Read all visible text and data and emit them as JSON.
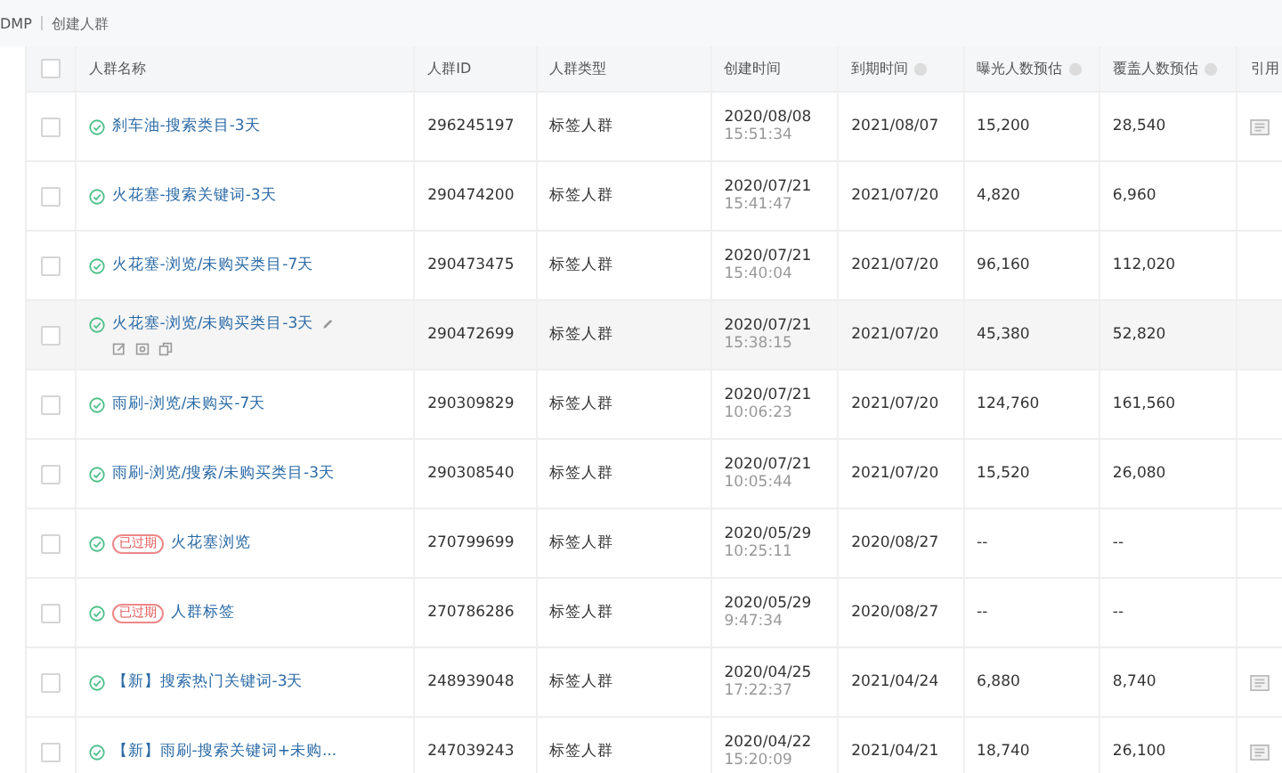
{
  "breadcrumb": [
    "DMP",
    "创建人群"
  ],
  "table": {
    "all_checked": false,
    "columns": [
      {
        "label": "人群名称",
        "help": false
      },
      {
        "label": "人群ID",
        "help": false
      },
      {
        "label": "人群类型",
        "help": false
      },
      {
        "label": "创建时间",
        "help": false
      },
      {
        "label": "到期时间",
        "help": true
      },
      {
        "label": "曝光人数预估",
        "help": true
      },
      {
        "label": "覆盖人数预估",
        "help": true
      },
      {
        "label": "引用"
      }
    ],
    "rows": [
      {
        "name": "刹车油-搜索类目-3天",
        "id": "296245197",
        "type": "标签人群",
        "created_date": "2020/08/08",
        "created_time": "15:51:34",
        "expiry": "2021/08/07",
        "exposure": "15,200",
        "coverage": "28,540",
        "referenced": true,
        "hovered": false,
        "checked": false
      },
      {
        "name": "火花塞-搜索关键词-3天",
        "id": "290474200",
        "type": "标签人群",
        "created_date": "2020/07/21",
        "created_time": "15:41:47",
        "expiry": "2021/07/20",
        "exposure": "4,820",
        "coverage": "6,960",
        "referenced": false,
        "hovered": false,
        "checked": false
      },
      {
        "name": "火花塞-浏览/未购买类目-7天",
        "id": "290473475",
        "type": "标签人群",
        "created_date": "2020/07/21",
        "created_time": "15:40:04",
        "expiry": "2021/07/20",
        "exposure": "96,160",
        "coverage": "112,020",
        "referenced": false,
        "hovered": false,
        "checked": false
      },
      {
        "name": "火花塞-浏览/未购买类目-3天",
        "id": "290472699",
        "type": "标签人群",
        "created_date": "2020/07/21",
        "created_time": "15:38:15",
        "expiry": "2021/07/20",
        "exposure": "45,380",
        "coverage": "52,820",
        "referenced": false,
        "hovered": true,
        "checked": false
      },
      {
        "name": "雨刷-浏览/未购买-7天",
        "id": "290309829",
        "type": "标签人群",
        "created_date": "2020/07/21",
        "created_time": "10:06:23",
        "expiry": "2021/07/20",
        "exposure": "124,760",
        "coverage": "161,560",
        "referenced": false,
        "hovered": false,
        "checked": false
      },
      {
        "name": "雨刷-浏览/搜索/未购买类目-3天",
        "id": "290308540",
        "type": "标签人群",
        "created_date": "2020/07/21",
        "created_time": "10:05:44",
        "expiry": "2021/07/20",
        "exposure": "15,520",
        "coverage": "26,080",
        "referenced": false,
        "hovered": false,
        "checked": false
      },
      {
        "name": "火花塞浏览",
        "badge": "已过期",
        "id": "270799699",
        "type": "标签人群",
        "created_date": "2020/05/29",
        "created_time": "10:25:11",
        "expiry": "2020/08/27",
        "exposure": "--",
        "coverage": "--",
        "referenced": false,
        "hovered": false,
        "checked": false
      },
      {
        "name": "人群标签",
        "badge": "已过期",
        "id": "270786286",
        "type": "标签人群",
        "created_date": "2020/05/29",
        "created_time": "9:47:34",
        "expiry": "2020/08/27",
        "exposure": "--",
        "coverage": "--",
        "referenced": false,
        "hovered": false,
        "checked": false
      },
      {
        "name": "【新】搜索热门关键词-3天",
        "id": "248939048",
        "type": "标签人群",
        "created_date": "2020/04/25",
        "created_time": "17:22:37",
        "expiry": "2021/04/24",
        "exposure": "6,880",
        "coverage": "8,740",
        "referenced": true,
        "hovered": false,
        "checked": false
      },
      {
        "name": "【新】雨刷-搜索关键词+未购...",
        "id": "247039243",
        "type": "标签人群",
        "created_date": "2020/04/22",
        "created_time": "15:20:09",
        "expiry": "2021/04/21",
        "exposure": "18,740",
        "coverage": "26,100",
        "referenced": true,
        "hovered": false,
        "checked": false
      }
    ]
  }
}
